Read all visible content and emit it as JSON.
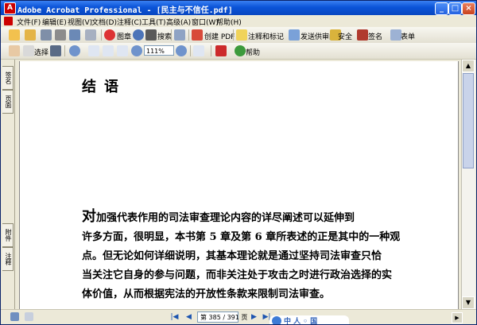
{
  "window": {
    "title": "Adobe Acrobat Professional - [民主与不信任.pdf]",
    "minimize": "_",
    "maximize": "□",
    "close": "×"
  },
  "menu": [
    "文件(F)",
    "编辑(E)",
    "视图(V)",
    "文档(D)",
    "注释(C)",
    "工具(T)",
    "高级(A)",
    "窗口(W)",
    "帮助(H)"
  ],
  "toolbar1": {
    "organize": "图章",
    "search": "搜索",
    "create_pdf": "创建 PDF",
    "comment_markup": "注释和标记",
    "send_review": "发送供审阅",
    "secure": "安全",
    "sign": "签名",
    "forms": "表单"
  },
  "toolbar2": {
    "select": "选择",
    "zoom_value": "111%",
    "help": "帮助"
  },
  "left_tabs": {
    "signatures": "签名",
    "pages": "页面",
    "comments": "注释",
    "attachments": "附件"
  },
  "document": {
    "heading": "结语",
    "first_char": "对",
    "lines": [
      "加强代表作用的司法审查理论内容的详尽阐述可以延伸到",
      "许多方面，很明显，本书第 5 章及第 6 章所表述的正是其中的一种观",
      "点。但无论如何详细说明，其基本理论就是通过坚持司法审查只恰",
      "当关注它自身的参与问题，而非关注处于攻击之时进行政治选择的实",
      "体价值，从而根据宪法的开放性条款来限制司法审查。"
    ]
  },
  "status": {
    "page_indicator": "第 385 / 391 页"
  },
  "watermark": {
    "text": "中 人 ◦ 国"
  }
}
